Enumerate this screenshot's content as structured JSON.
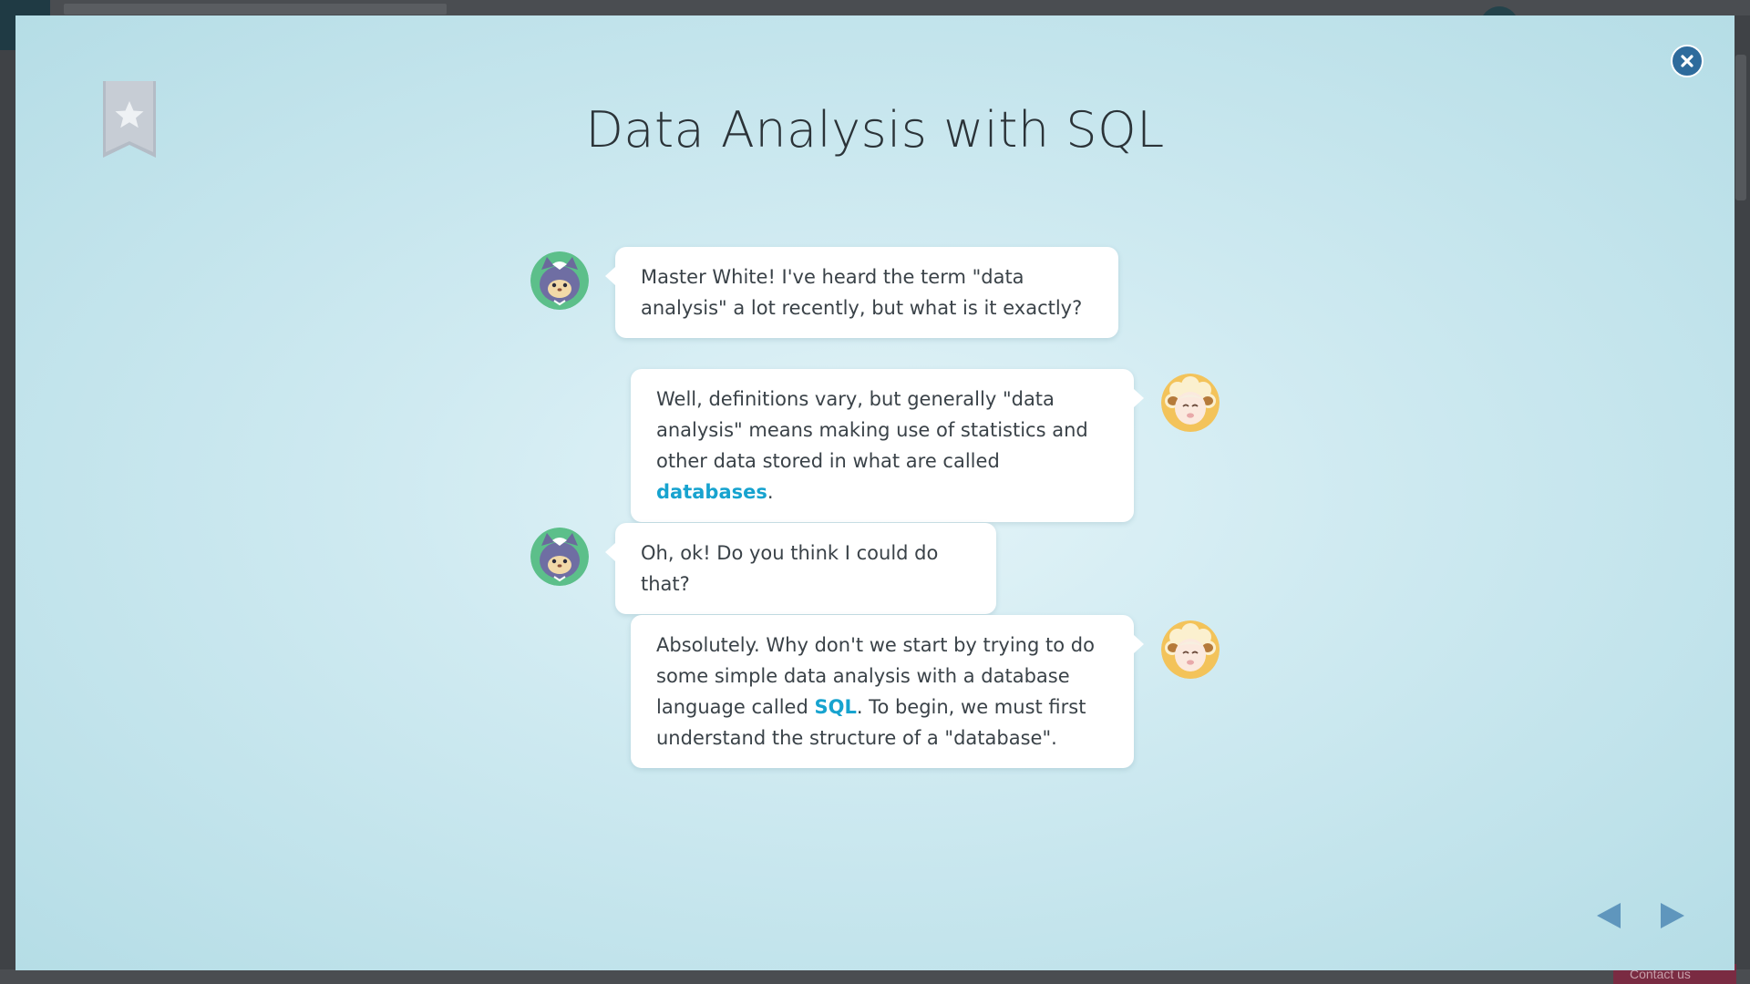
{
  "title": "Data Analysis with SQL",
  "colors": {
    "keyword": "#17a3cf",
    "nav_arrow": "#5f96bd",
    "close_button": "#2e6b9c",
    "bookmark": "#c3c9d1"
  },
  "icons": {
    "bookmark": "bookmark-star-icon",
    "close": "close-icon",
    "prev": "previous-arrow-icon",
    "next": "next-arrow-icon",
    "student": "cat-character-avatar",
    "teacher": "sheep-character-avatar"
  },
  "background": {
    "contact_label": "Contact us"
  },
  "dialogue": [
    {
      "speaker": "student",
      "parts": [
        "Master White! I've heard the term \"data analysis\" a lot recently, but what is it exactly?"
      ]
    },
    {
      "speaker": "teacher",
      "parts": [
        "Well, definitions vary, but generally \"data analysis\" means making use of statistics and other data stored in what are called ",
        "databases",
        "."
      ]
    },
    {
      "speaker": "student",
      "parts": [
        "Oh, ok! Do you think I could do that?"
      ]
    },
    {
      "speaker": "teacher",
      "parts": [
        "Absolutely. Why don't we start by trying to do some simple data analysis with a database language called ",
        "SQL",
        ". To begin, we must first understand the structure of a \"database\"."
      ]
    }
  ]
}
